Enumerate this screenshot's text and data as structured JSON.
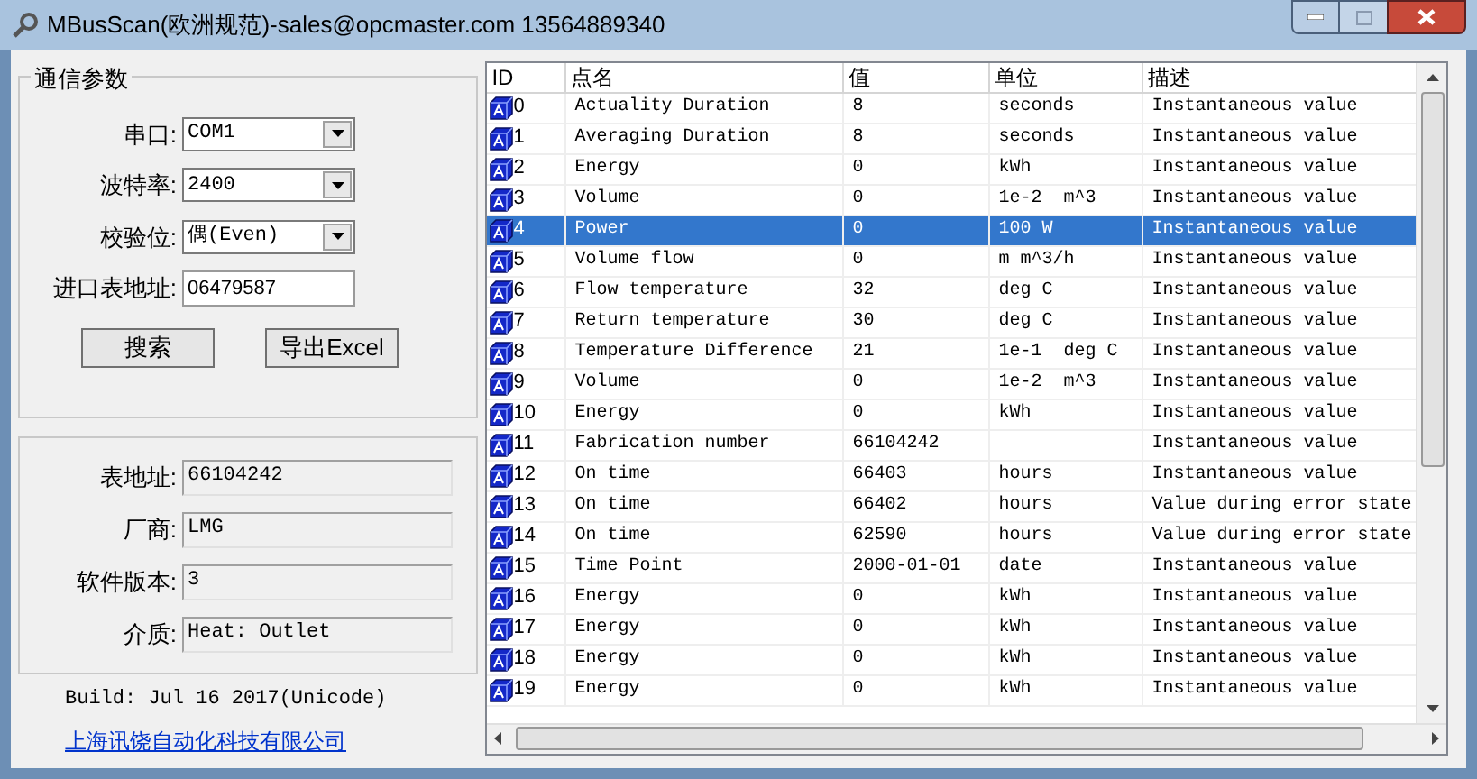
{
  "window": {
    "title": "MBusScan(欧洲规范)-sales@opcmaster.com 13564889340"
  },
  "comm": {
    "title": "通信参数",
    "fields": [
      {
        "label": "串口:",
        "kind": "select",
        "value": "COM1"
      },
      {
        "label": "波特率:",
        "kind": "select",
        "value": "2400"
      },
      {
        "label": "校验位:",
        "kind": "select",
        "value": "偶(Even)"
      },
      {
        "label": "进口表地址:",
        "kind": "input",
        "value": "06479587"
      }
    ],
    "buttons": [
      "搜索",
      "导出Excel"
    ]
  },
  "info": {
    "fields": [
      {
        "label": "表地址:",
        "value": "66104242"
      },
      {
        "label": "厂商:",
        "value": "LMG"
      },
      {
        "label": "软件版本:",
        "value": "3"
      },
      {
        "label": "介质:",
        "value": "Heat: Outlet"
      }
    ]
  },
  "build": "Build: Jul 16 2017(Unicode)",
  "link": "上海讯饶自动化科技有限公司",
  "table": {
    "columns": [
      "ID",
      "点名",
      "值",
      "单位",
      "描述"
    ],
    "rows": [
      {
        "id": "0",
        "name": "Actuality Duration",
        "value": "8",
        "unit": "seconds",
        "desc": "Instantaneous value",
        "selected": false
      },
      {
        "id": "1",
        "name": "Averaging Duration",
        "value": "8",
        "unit": "seconds",
        "desc": "Instantaneous value",
        "selected": false
      },
      {
        "id": "2",
        "name": "Energy",
        "value": "0",
        "unit": "kWh",
        "desc": "Instantaneous value",
        "selected": false
      },
      {
        "id": "3",
        "name": "Volume",
        "value": "0",
        "unit": "1e-2  m^3",
        "desc": "Instantaneous value",
        "selected": false
      },
      {
        "id": "4",
        "name": "Power",
        "value": "0",
        "unit": "100 W",
        "desc": "Instantaneous value",
        "selected": true
      },
      {
        "id": "5",
        "name": "Volume flow",
        "value": "0",
        "unit": "m m^3/h",
        "desc": "Instantaneous value",
        "selected": false
      },
      {
        "id": "6",
        "name": "Flow temperature",
        "value": "32",
        "unit": "deg C",
        "desc": "Instantaneous value",
        "selected": false
      },
      {
        "id": "7",
        "name": "Return temperature",
        "value": "30",
        "unit": "deg C",
        "desc": "Instantaneous value",
        "selected": false
      },
      {
        "id": "8",
        "name": "Temperature Difference",
        "value": "21",
        "unit": "1e-1  deg C",
        "desc": "Instantaneous value",
        "selected": false
      },
      {
        "id": "9",
        "name": "Volume",
        "value": "0",
        "unit": "1e-2  m^3",
        "desc": "Instantaneous value",
        "selected": false
      },
      {
        "id": "10",
        "name": "Energy",
        "value": "0",
        "unit": "kWh",
        "desc": "Instantaneous value",
        "selected": false
      },
      {
        "id": "11",
        "name": "Fabrication number",
        "value": "66104242",
        "unit": "",
        "desc": "Instantaneous value",
        "selected": false
      },
      {
        "id": "12",
        "name": "On time",
        "value": "66403",
        "unit": "hours",
        "desc": "Instantaneous value",
        "selected": false
      },
      {
        "id": "13",
        "name": "On time",
        "value": "66402",
        "unit": "hours",
        "desc": "Value during error state",
        "selected": false
      },
      {
        "id": "14",
        "name": "On time",
        "value": "62590",
        "unit": "hours",
        "desc": "Value during error state",
        "selected": false
      },
      {
        "id": "15",
        "name": "Time Point",
        "value": "2000-01-01",
        "unit": "date",
        "desc": "Instantaneous value",
        "selected": false
      },
      {
        "id": "16",
        "name": "Energy",
        "value": "0",
        "unit": "kWh",
        "desc": "Instantaneous value",
        "selected": false
      },
      {
        "id": "17",
        "name": "Energy",
        "value": "0",
        "unit": "kWh",
        "desc": "Instantaneous value",
        "selected": false
      },
      {
        "id": "18",
        "name": "Energy",
        "value": "0",
        "unit": "kWh",
        "desc": "Instantaneous value",
        "selected": false
      },
      {
        "id": "19",
        "name": "Energy",
        "value": "0",
        "unit": "kWh",
        "desc": "Instantaneous value",
        "selected": false
      }
    ]
  }
}
